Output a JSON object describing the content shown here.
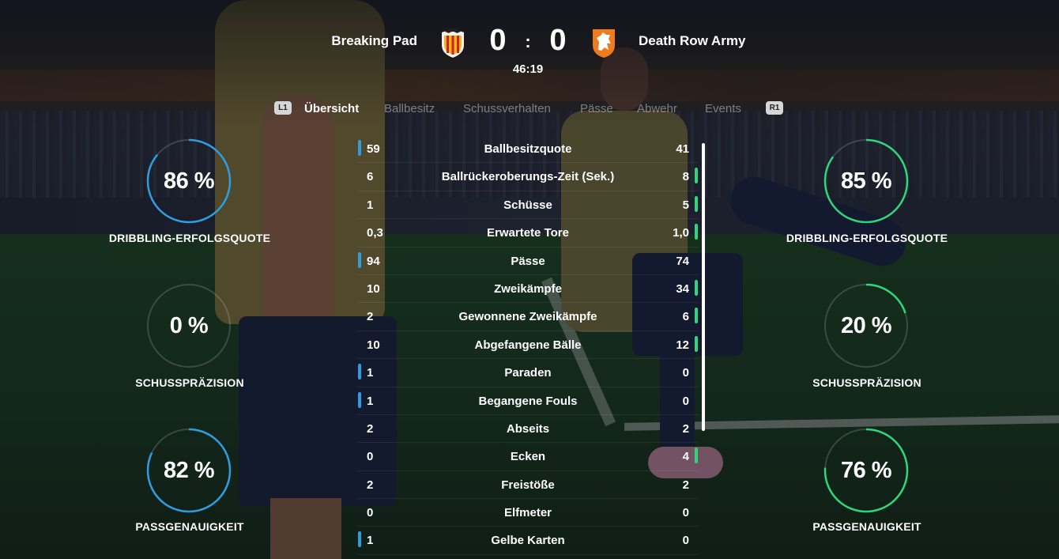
{
  "match": {
    "home_team": "Breaking Pad",
    "away_team": "Death Row Army",
    "home_score": "0",
    "away_score": "0",
    "separator": ":",
    "clock": "46:19"
  },
  "tabs": {
    "left_button": "L1",
    "right_button": "R1",
    "items": [
      "Übersicht",
      "Ballbesitz",
      "Schussverhalten",
      "Pässe",
      "Abwehr",
      "Events"
    ],
    "active": "Übersicht"
  },
  "colors": {
    "home_accent": "#2f9ee0",
    "away_accent": "#2fd67a"
  },
  "gauges": {
    "home": [
      {
        "value_text": "86 %",
        "value": 86,
        "label": "DRIBBLING-ERFOLGSQUOTE"
      },
      {
        "value_text": "0 %",
        "value": 0,
        "label": "SCHUSSPRÄZISION"
      },
      {
        "value_text": "82 %",
        "value": 82,
        "label": "PASSGENAUIGKEIT"
      }
    ],
    "away": [
      {
        "value_text": "85 %",
        "value": 85,
        "label": "DRIBBLING-ERFOLGSQUOTE"
      },
      {
        "value_text": "20 %",
        "value": 20,
        "label": "SCHUSSPRÄZISION"
      },
      {
        "value_text": "76 %",
        "value": 76,
        "label": "PASSGENAUIGKEIT"
      }
    ]
  },
  "stats": [
    {
      "home": "59",
      "label": "Ballbesitzquote",
      "away": "41",
      "lead": "home"
    },
    {
      "home": "6",
      "label": "Ballrückeroberungs-Zeit (Sek.)",
      "away": "8",
      "lead": "away"
    },
    {
      "home": "1",
      "label": "Schüsse",
      "away": "5",
      "lead": "away"
    },
    {
      "home": "0,3",
      "label": "Erwartete Tore",
      "away": "1,0",
      "lead": "away"
    },
    {
      "home": "94",
      "label": "Pässe",
      "away": "74",
      "lead": "home"
    },
    {
      "home": "10",
      "label": "Zweikämpfe",
      "away": "34",
      "lead": "away"
    },
    {
      "home": "2",
      "label": "Gewonnene Zweikämpfe",
      "away": "6",
      "lead": "away"
    },
    {
      "home": "10",
      "label": "Abgefangene Bälle",
      "away": "12",
      "lead": "away"
    },
    {
      "home": "1",
      "label": "Paraden",
      "away": "0",
      "lead": "home"
    },
    {
      "home": "1",
      "label": "Begangene Fouls",
      "away": "0",
      "lead": "home"
    },
    {
      "home": "2",
      "label": "Abseits",
      "away": "2",
      "lead": "none"
    },
    {
      "home": "0",
      "label": "Ecken",
      "away": "4",
      "lead": "away"
    },
    {
      "home": "2",
      "label": "Freistöße",
      "away": "2",
      "lead": "none"
    },
    {
      "home": "0",
      "label": "Elfmeter",
      "away": "0",
      "lead": "none"
    },
    {
      "home": "1",
      "label": "Gelbe Karten",
      "away": "0",
      "lead": "home"
    }
  ]
}
